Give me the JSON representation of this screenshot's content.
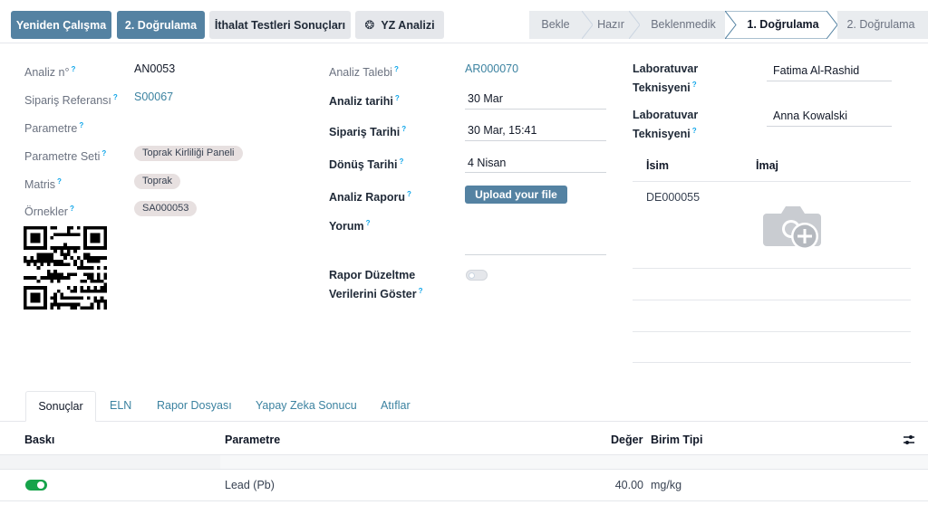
{
  "toolbar": {
    "restart_label": "Yeniden Çalışma",
    "validate2_label": "2. Doğrulama",
    "import_label": "İthalat Testleri Sonuçları",
    "ai_label": "YZ Analizi"
  },
  "status": {
    "steps": [
      "Bekle",
      "Hazır",
      "Beklenmedik",
      "1. Doğrulama",
      "2. Doğrulama"
    ],
    "active_index": 3
  },
  "left": {
    "analysis_no_label": "Analiz n°",
    "analysis_no": "AN0053",
    "order_ref_label": "Sipariş Referansı",
    "order_ref": "S00067",
    "parameter_label": "Parametre",
    "parameter_set_label": "Parametre Seti",
    "parameter_set": "Toprak Kirliliği Paneli",
    "matrix_label": "Matris",
    "matrix": "Toprak",
    "samples_label": "Örnekler",
    "sample": "SA000053"
  },
  "middle": {
    "request_label": "Analiz Talebi",
    "request": "AR000070",
    "date_label": "Analiz tarihi",
    "date": "30 Mar",
    "order_date_label": "Sipariş Tarihi",
    "order_date": "30 Mar, 15:41",
    "return_date_label": "Dönüş Tarihi",
    "return_date": "4 Nisan",
    "report_label": "Analiz Raporu",
    "upload_label": "Upload your file",
    "comment_label": "Yorum",
    "correction_label_1": "Rapor Düzeltme",
    "correction_label_2": "Verilerini Göster",
    "correction_on": false
  },
  "right": {
    "tech1_label_1": "Laboratuvar",
    "tech1_label_2": "Teknisyeni",
    "tech1": "Fatima Al-Rashid",
    "tech2_label_1": "Laboratuvar",
    "tech2_label_2": "Teknisyeni",
    "tech2": "Anna Kowalski",
    "col_name": "İsim",
    "col_image": "İmaj",
    "row_name": "DE000055"
  },
  "tabs": [
    "Sonuçlar",
    "ELN",
    "Rapor Dosyası",
    "Yapay Zeka Sonucu",
    "Atıflar"
  ],
  "results": {
    "headers": {
      "print": "Baskı",
      "parameter": "Parametre",
      "value": "Değer",
      "unit": "Birim Tipi"
    },
    "rows": [
      {
        "print": true,
        "parameter": "Lead (Pb)",
        "value": "40.00",
        "unit": "mg/kg"
      }
    ]
  },
  "colors": {
    "primary": "#5482a2",
    "link": "#3b82a0",
    "toggle_on": "#16a34a"
  }
}
